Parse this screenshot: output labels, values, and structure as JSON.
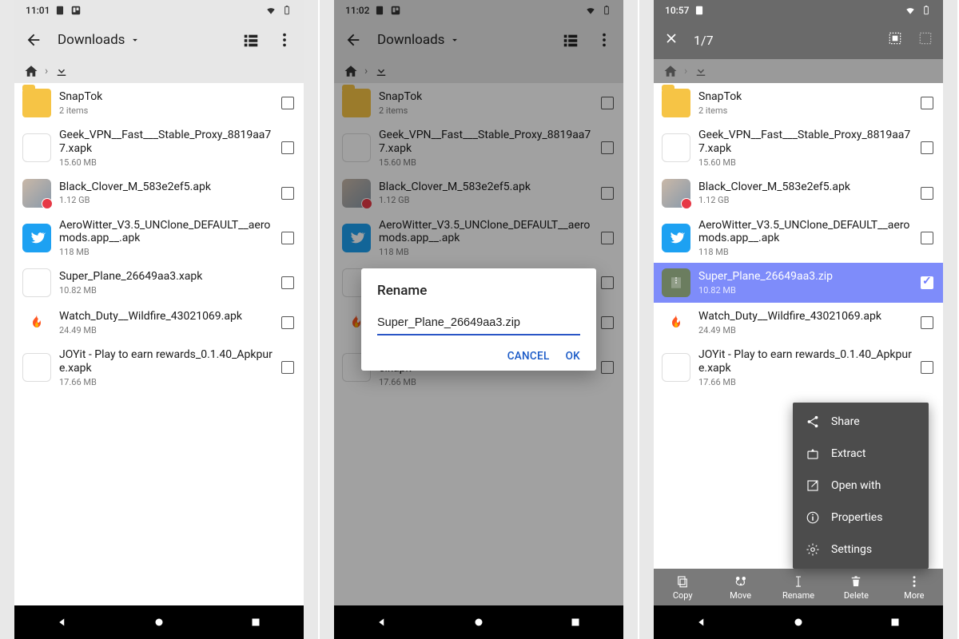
{
  "panel1": {
    "status_time": "11:01",
    "title": "Downloads",
    "files": [
      {
        "name": "SnapTok",
        "sub": "2 items",
        "type": "folder"
      },
      {
        "name": "Geek_VPN__Fast___Stable_Proxy_8819aa77.xapk",
        "sub": "15.60 MB",
        "type": "blank"
      },
      {
        "name": "Black_Clover_M_583e2ef5.apk",
        "sub": "1.12 GB",
        "type": "anime"
      },
      {
        "name": "AeroWitter_V3.5_UNClone_DEFAULT__aeromods.app__.apk",
        "sub": "118 MB",
        "type": "twitter"
      },
      {
        "name": "Super_Plane_26649aa3.xapk",
        "sub": "10.82 MB",
        "type": "blank"
      },
      {
        "name": "Watch_Duty__Wildfire_43021069.apk",
        "sub": "24.49 MB",
        "type": "flame"
      },
      {
        "name": "JOYit - Play to earn rewards_0.1.40_Apkpure.xapk",
        "sub": "17.66 MB",
        "type": "blank"
      }
    ]
  },
  "panel2": {
    "status_time": "11:02",
    "title": "Downloads",
    "dialog": {
      "title": "Rename",
      "value": "Super_Plane_26649aa3.zip",
      "cancel": "CANCEL",
      "ok": "OK"
    },
    "files_same_as_panel1": true
  },
  "panel3": {
    "status_time": "10:57",
    "selection_count": "1/7",
    "files": [
      {
        "name": "SnapTok",
        "sub": "2 items",
        "type": "folder"
      },
      {
        "name": "Geek_VPN__Fast___Stable_Proxy_8819aa77.xapk",
        "sub": "15.60 MB",
        "type": "blank"
      },
      {
        "name": "Black_Clover_M_583e2ef5.apk",
        "sub": "1.12 GB",
        "type": "anime"
      },
      {
        "name": "AeroWitter_V3.5_UNClone_DEFAULT__aeromods.app__.apk",
        "sub": "118 MB",
        "type": "twitter"
      },
      {
        "name": "Super_Plane_26649aa3.zip",
        "sub": "10.82 MB",
        "type": "zip",
        "selected": true
      },
      {
        "name": "Watch_Duty__Wildfire_43021069.apk",
        "sub": "24.49 MB",
        "type": "flame"
      },
      {
        "name": "JOYit - Play to earn rewards_0.1.40_Apkpure.xapk",
        "sub": "17.66 MB",
        "type": "blank"
      }
    ],
    "popup": {
      "items": [
        "Share",
        "Extract",
        "Open with",
        "Properties",
        "Settings"
      ]
    },
    "bottombar": [
      "Copy",
      "Move",
      "Rename",
      "Delete",
      "More"
    ]
  }
}
